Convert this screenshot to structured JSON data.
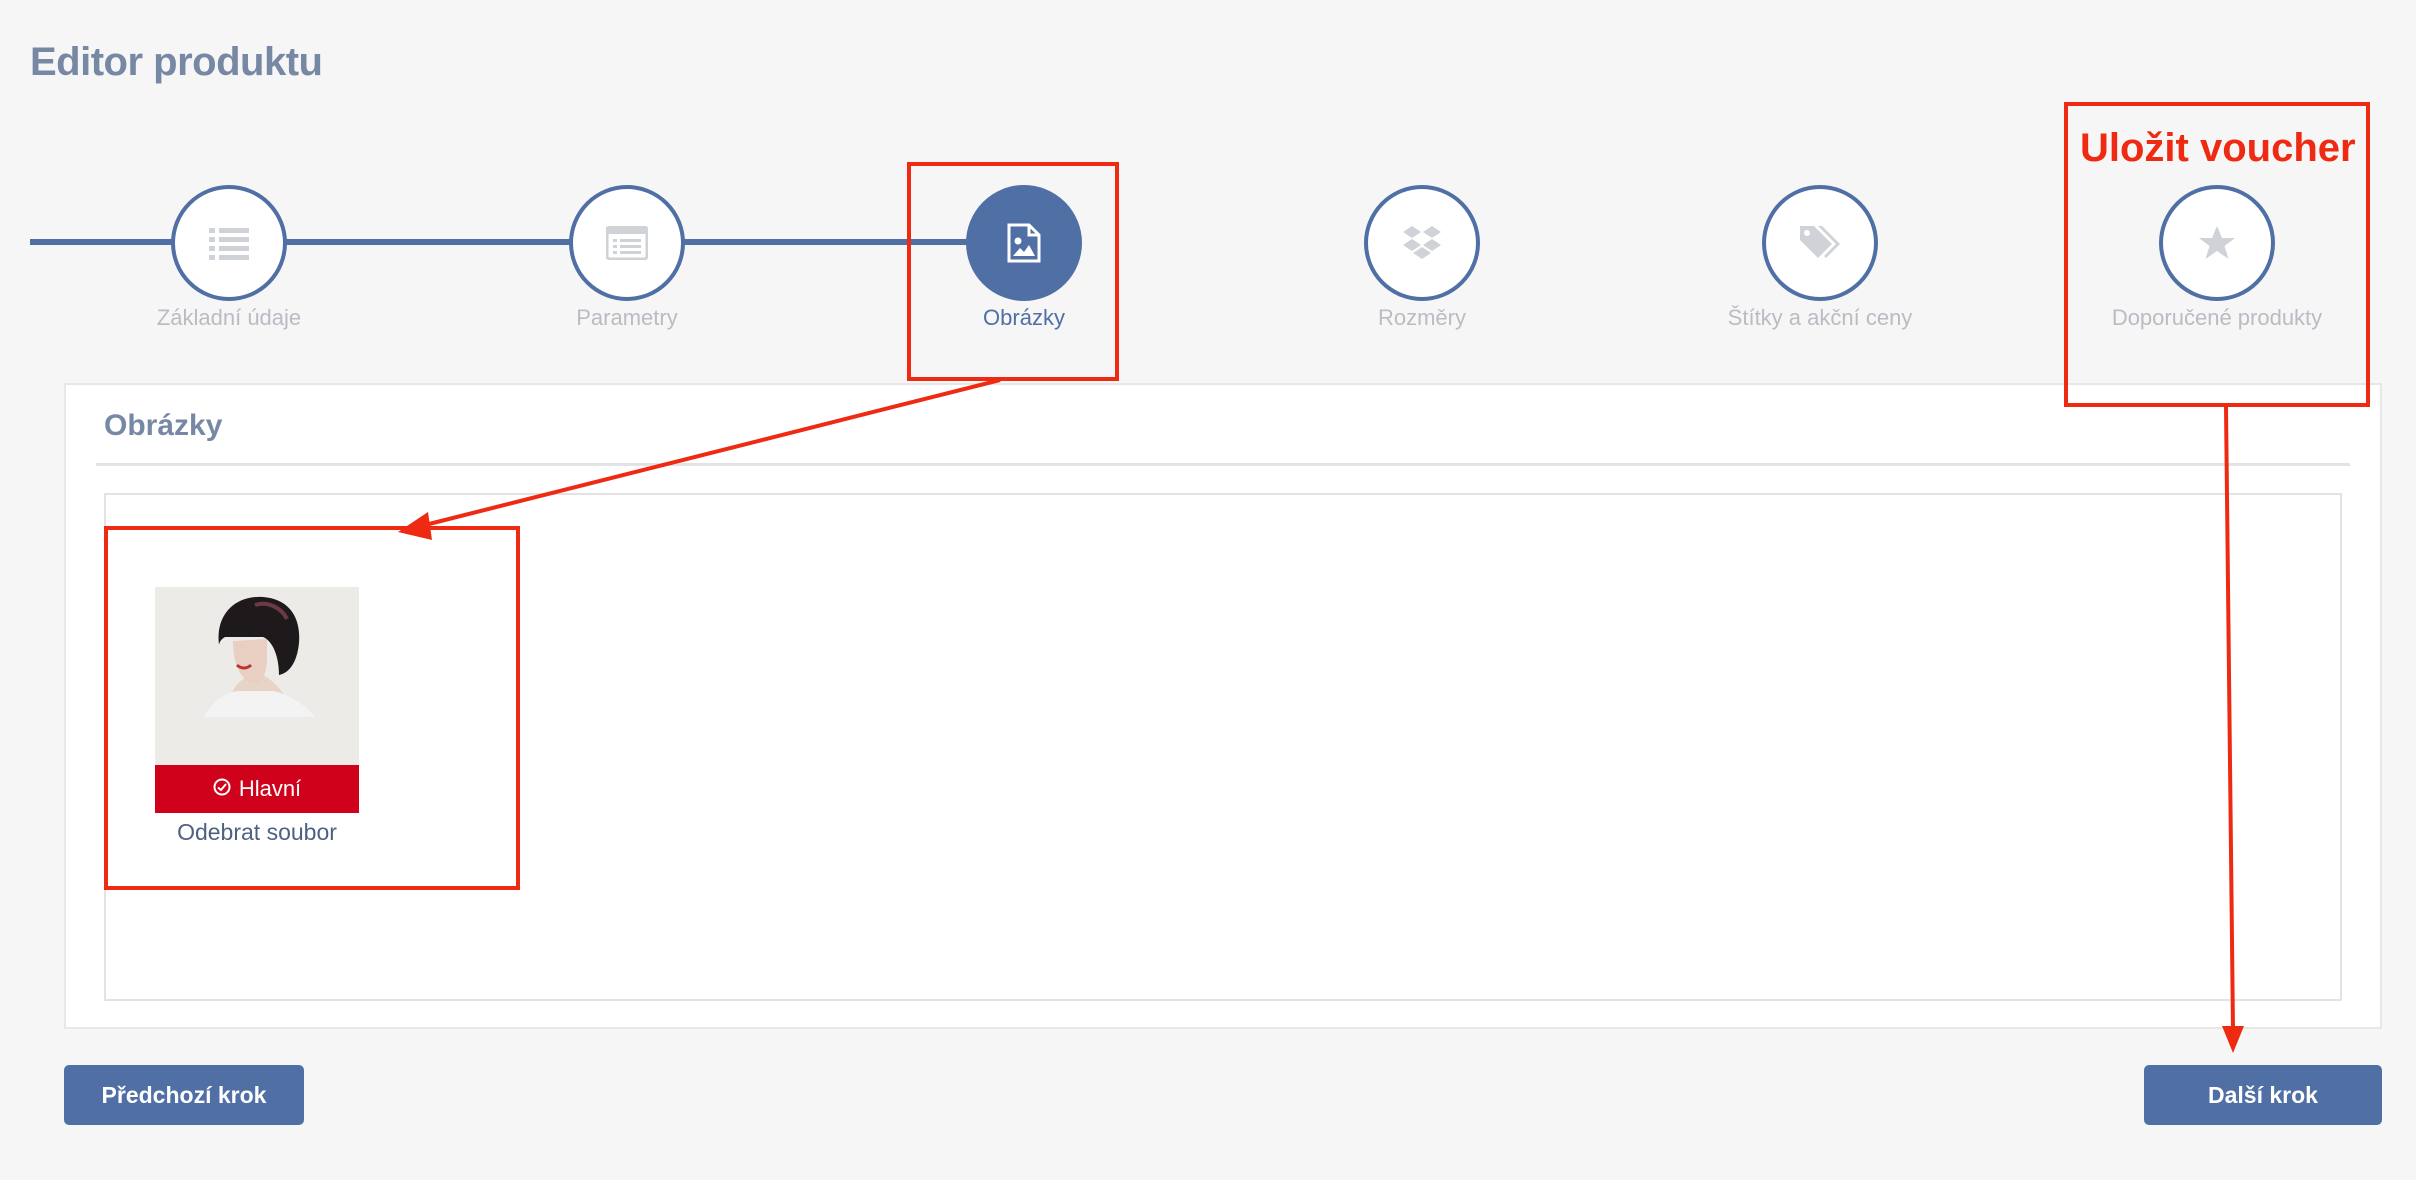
{
  "page": {
    "title": "Editor produktu"
  },
  "wizard": {
    "steps": [
      {
        "label": "Základní údaje",
        "icon": "list-icon",
        "active": false
      },
      {
        "label": "Parametry",
        "icon": "window-list-icon",
        "active": false
      },
      {
        "label": "Obrázky",
        "icon": "image-file-icon",
        "active": true
      },
      {
        "label": "Rozměry",
        "icon": "dropbox-icon",
        "active": false
      },
      {
        "label": "Štítky a akční ceny",
        "icon": "tags-icon",
        "active": false
      },
      {
        "label": "Doporučené produkty",
        "icon": "star-icon",
        "active": false
      }
    ]
  },
  "panel": {
    "title": "Obrázky",
    "image": {
      "badge": "Hlavní",
      "badge_icon": "check-circle-icon",
      "remove_label": "Odebrat soubor"
    }
  },
  "buttons": {
    "prev": "Předchozí krok",
    "next": "Další krok"
  },
  "annotations": {
    "save_voucher": "Uložit voucher"
  },
  "colors": {
    "accent": "#4f6fa5",
    "badge_red": "#d0021b",
    "annotation_red": "#ee2b12",
    "title_gray": "#7688a3"
  }
}
